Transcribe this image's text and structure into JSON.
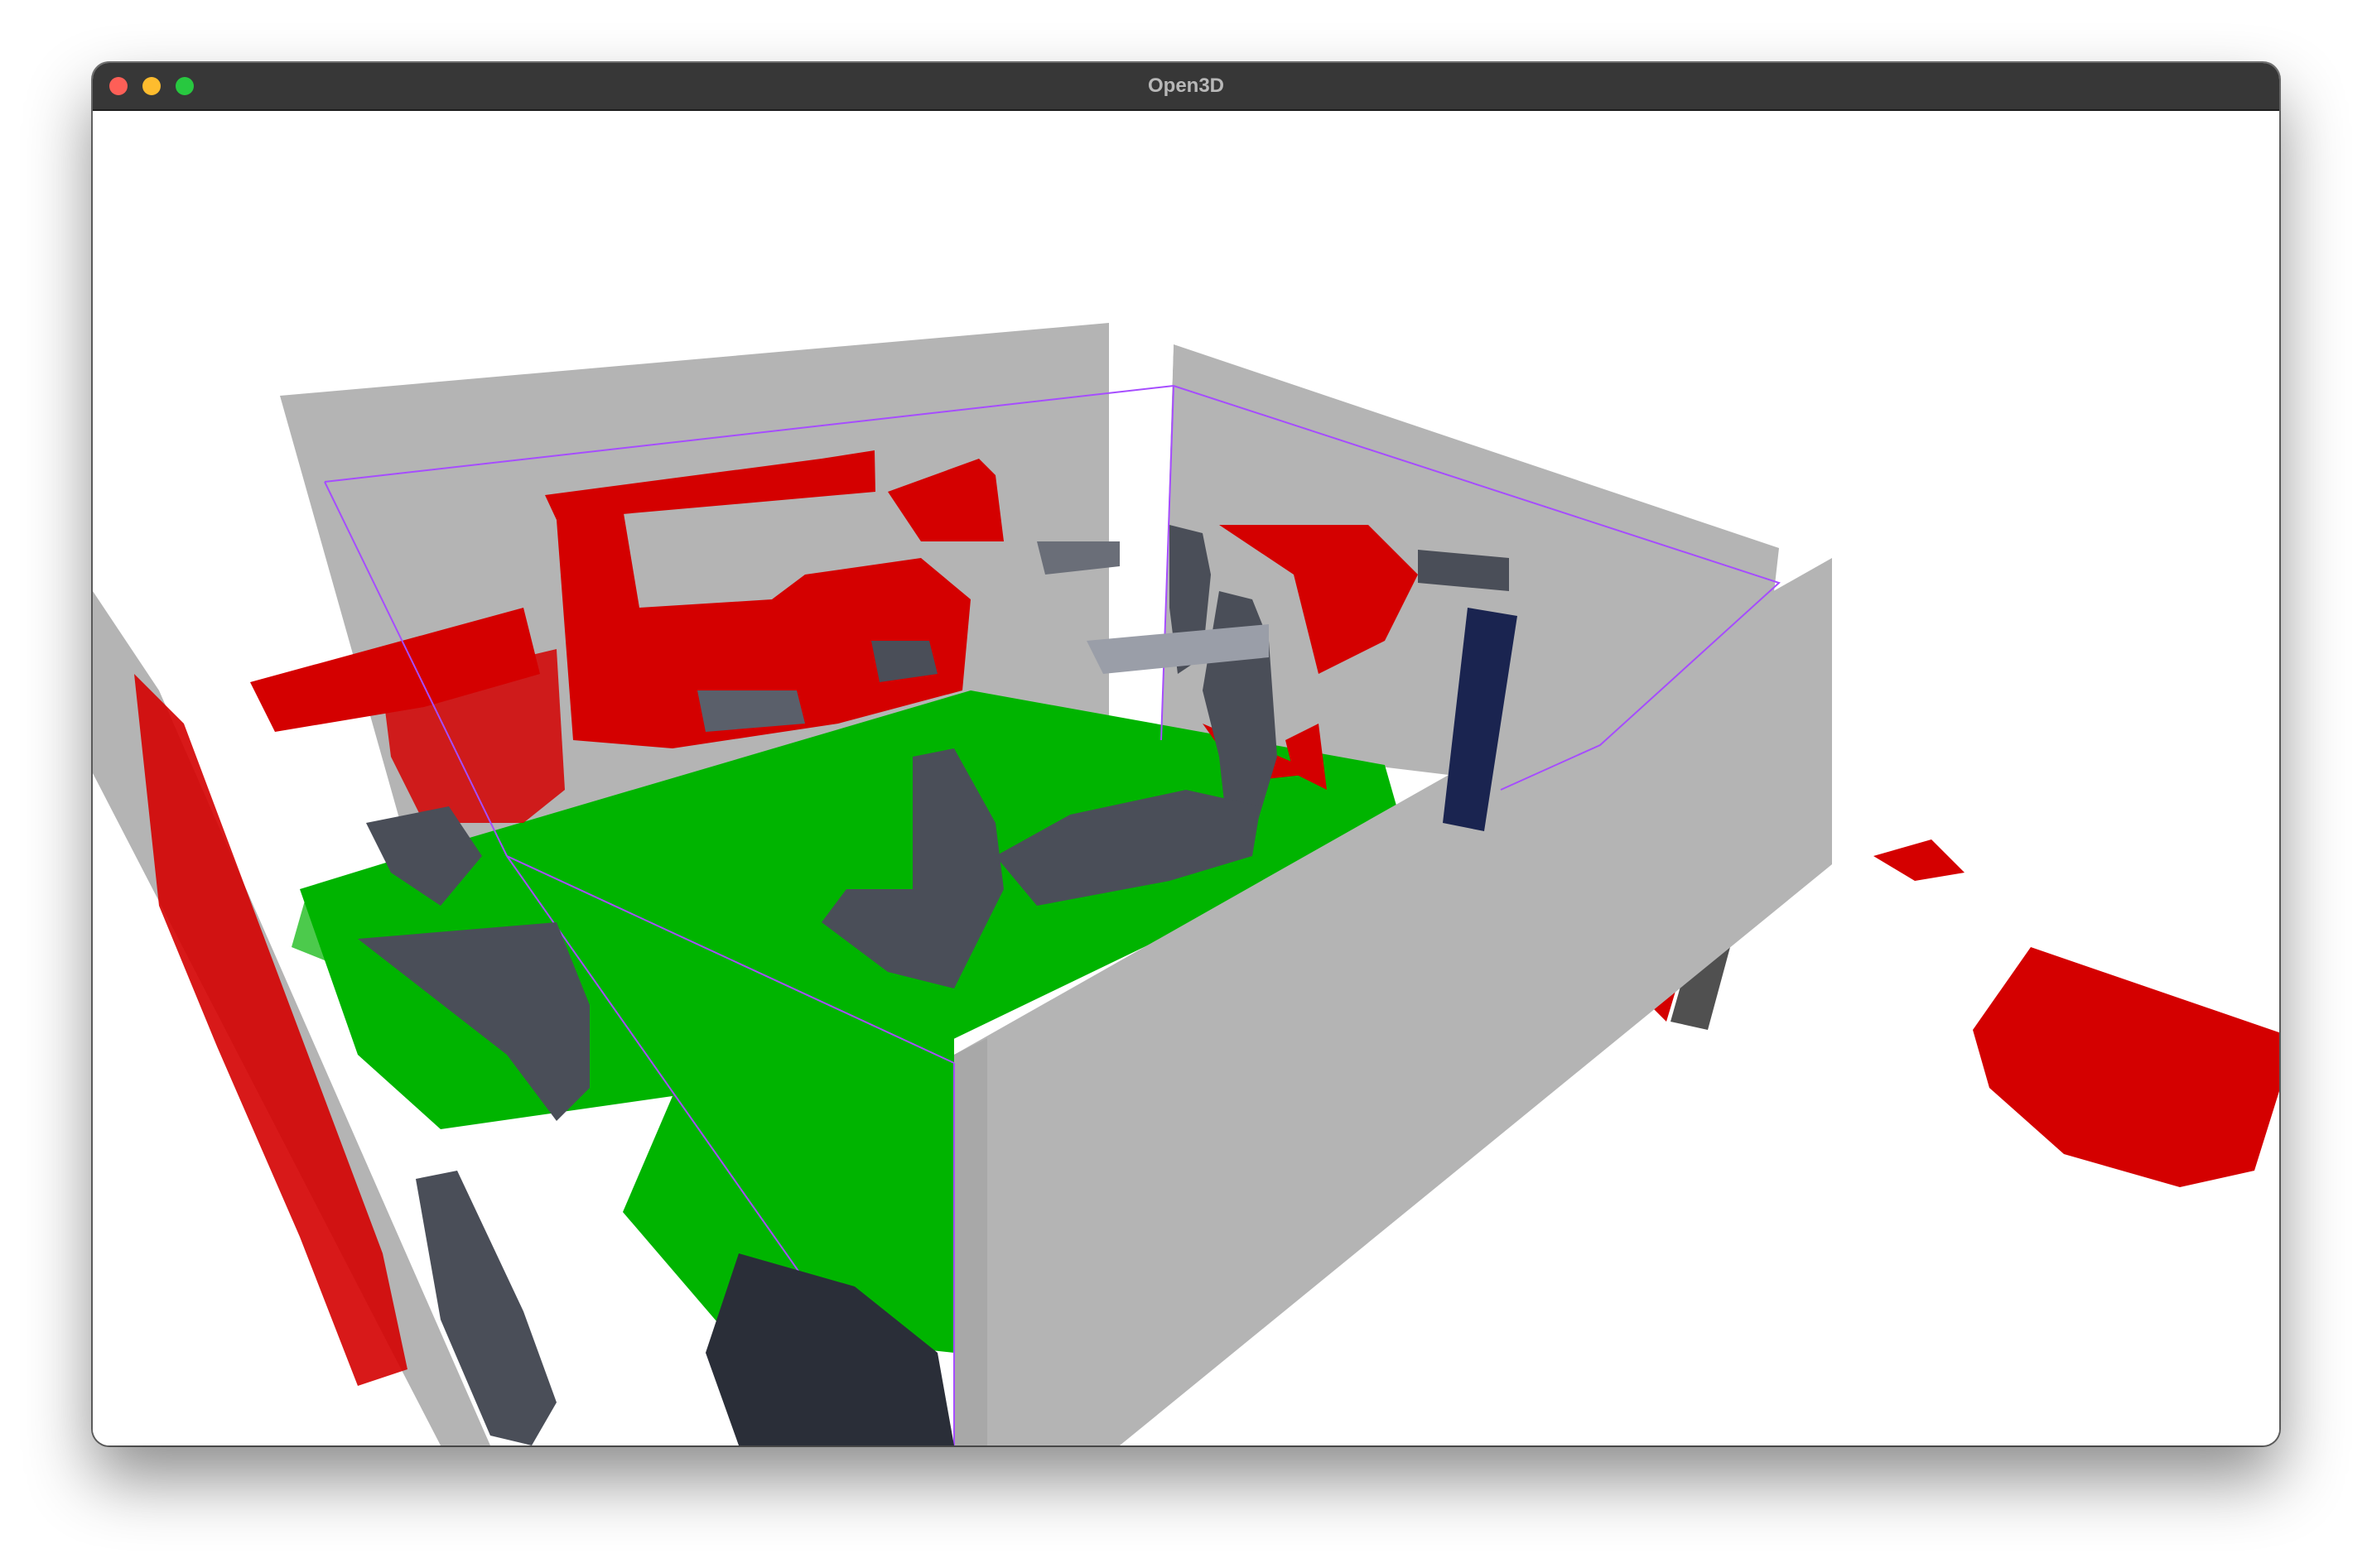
{
  "window": {
    "title": "Open3D"
  },
  "colors": {
    "wall_plane": "#b4b4b4",
    "floor_points": "#00b400",
    "wall_points": "#d40000",
    "bbox_line": "#a64dff",
    "object_points": "#4a4e58",
    "background": "#ffffff"
  },
  "icons": {
    "close": "close-button-icon",
    "minimize": "minimize-button-icon",
    "maximize": "zoom-button-icon"
  }
}
